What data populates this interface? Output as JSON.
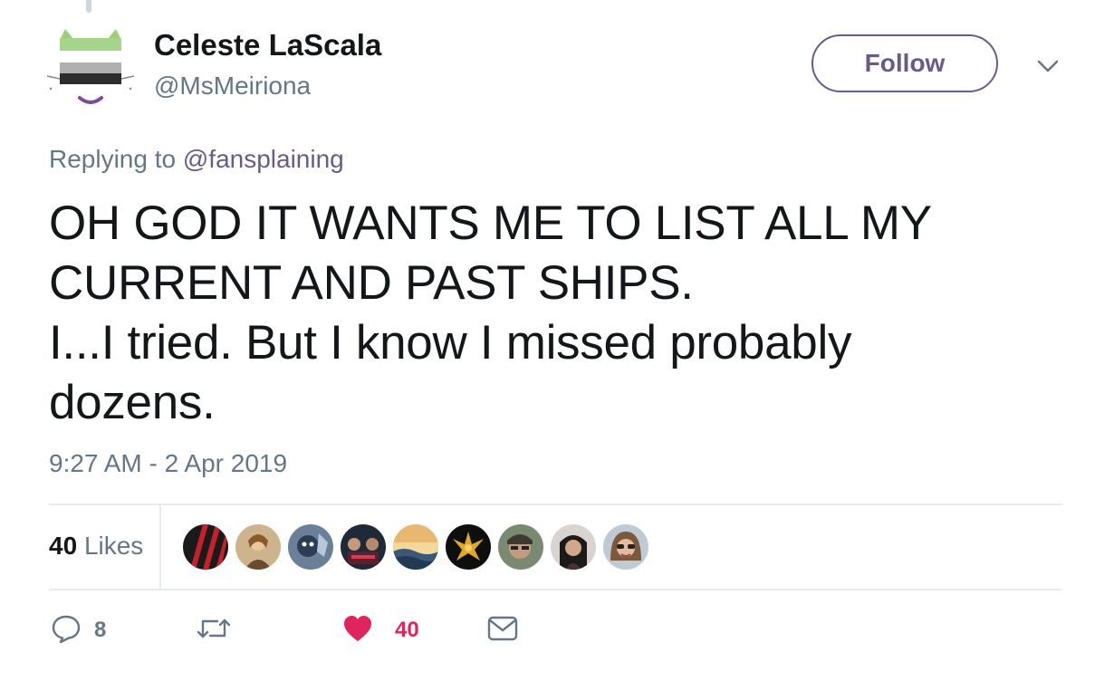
{
  "tweet": {
    "author": {
      "display_name": "Celeste LaScala",
      "handle": "@MsMeiriona",
      "avatar": "pride-flag-cat-avatar"
    },
    "follow_label": "Follow",
    "replying_prefix": "Replying to ",
    "replying_to": "@fansplaining",
    "text_lines": [
      "OH GOD IT WANTS ME TO LIST ALL MY",
      "CURRENT AND PAST SHIPS.",
      "I...I tried. But I know I missed probably",
      "dozens."
    ],
    "timestamp": "9:27 AM - 2 Apr 2019",
    "likes_count": "40",
    "likes_label": "Likes",
    "likers": [
      "liker-avatar-1",
      "liker-avatar-2",
      "liker-avatar-3",
      "liker-avatar-4",
      "liker-avatar-5",
      "liker-avatar-6",
      "liker-avatar-7",
      "liker-avatar-8",
      "liker-avatar-9"
    ],
    "actions": {
      "reply_count": "8",
      "retweet_count": "",
      "like_count": "40"
    }
  },
  "colors": {
    "accent": "#6b5a88",
    "text": "#14171a",
    "secondary": "#657786",
    "like": "#e0245e",
    "divider": "#e6ecf0"
  },
  "icons": {
    "chevron": "chevron-down-icon",
    "reply": "reply-icon",
    "retweet": "retweet-icon",
    "like": "heart-icon",
    "message": "envelope-icon"
  }
}
